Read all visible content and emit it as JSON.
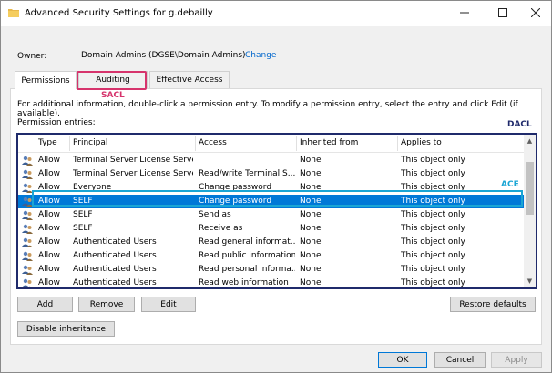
{
  "window": {
    "title": "Advanced Security Settings for g.debailly"
  },
  "owner": {
    "label": "Owner:",
    "value": "Domain Admins (DGSE\\Domain Admins)",
    "change_link": "Change"
  },
  "tabs": [
    {
      "label": "Permissions",
      "selected": true
    },
    {
      "label": "Auditing",
      "selected": false
    },
    {
      "label": "Effective Access",
      "selected": false
    }
  ],
  "annotations": {
    "sacl": "SACL",
    "dacl": "DACL",
    "ace": "ACE"
  },
  "info_text": "For additional information, double-click a permission entry. To modify a permission entry, select the entry and click Edit (if available).",
  "entries_label": "Permission entries:",
  "columns": [
    "Type",
    "Principal",
    "Access",
    "Inherited from",
    "Applies to"
  ],
  "rows": [
    {
      "type": "Allow",
      "principal": "Terminal Server License Serve...",
      "access": "",
      "inherited": "None",
      "applies": "This object only",
      "selected": false
    },
    {
      "type": "Allow",
      "principal": "Terminal Server License Serve...",
      "access": "Read/write Terminal S...",
      "inherited": "None",
      "applies": "This object only",
      "selected": false
    },
    {
      "type": "Allow",
      "principal": "Everyone",
      "access": "Change password",
      "inherited": "None",
      "applies": "This object only",
      "selected": false
    },
    {
      "type": "Allow",
      "principal": "SELF",
      "access": "Change password",
      "inherited": "None",
      "applies": "This object only",
      "selected": true
    },
    {
      "type": "Allow",
      "principal": "SELF",
      "access": "Send as",
      "inherited": "None",
      "applies": "This object only",
      "selected": false
    },
    {
      "type": "Allow",
      "principal": "SELF",
      "access": "Receive as",
      "inherited": "None",
      "applies": "This object only",
      "selected": false
    },
    {
      "type": "Allow",
      "principal": "Authenticated Users",
      "access": "Read general informat...",
      "inherited": "None",
      "applies": "This object only",
      "selected": false
    },
    {
      "type": "Allow",
      "principal": "Authenticated Users",
      "access": "Read public information",
      "inherited": "None",
      "applies": "This object only",
      "selected": false
    },
    {
      "type": "Allow",
      "principal": "Authenticated Users",
      "access": "Read personal informa...",
      "inherited": "None",
      "applies": "This object only",
      "selected": false
    },
    {
      "type": "Allow",
      "principal": "Authenticated Users",
      "access": "Read web information",
      "inherited": "None",
      "applies": "This object only",
      "selected": false
    }
  ],
  "buttons": {
    "add": "Add",
    "remove": "Remove",
    "edit": "Edit",
    "restore_defaults": "Restore defaults",
    "disable_inheritance": "Disable inheritance",
    "ok": "OK",
    "cancel": "Cancel",
    "apply": "Apply"
  },
  "colors": {
    "selection": "#0078d7",
    "sacl_highlight": "#d6336c",
    "dacl_highlight": "#1f2a6b",
    "ace_highlight": "#1aa5d4",
    "link": "#0066cc"
  }
}
